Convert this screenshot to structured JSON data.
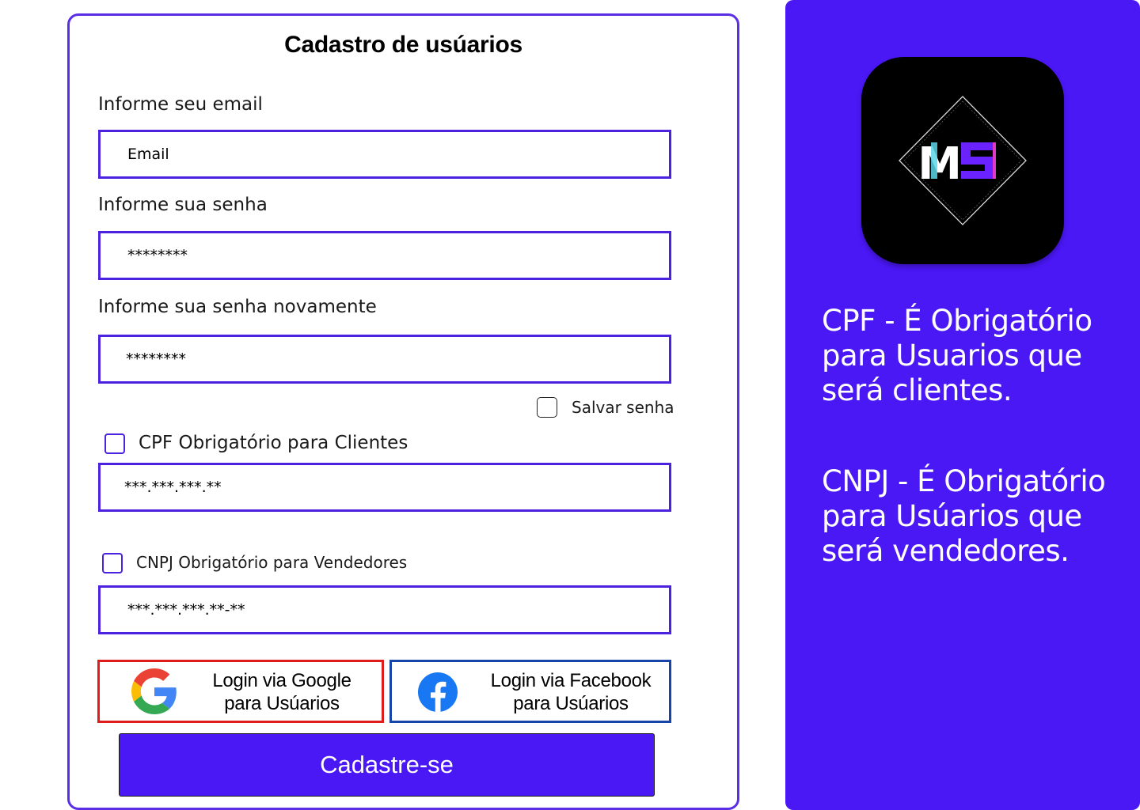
{
  "form": {
    "title": "Cadastro de usúarios",
    "email_label": "Informe seu email",
    "email_placeholder": "Email",
    "password_label": "Informe sua senha",
    "password_placeholder": "********",
    "password_confirm_label": "Informe sua senha novamente",
    "password_confirm_placeholder": "********",
    "save_password_label": "Salvar senha",
    "cpf_checkbox_label": "CPF Obrigatório para Clientes",
    "cpf_placeholder": "***.***.***.**",
    "cnpj_checkbox_label": "CNPJ Obrigatório para Vendedores",
    "cnpj_placeholder": "***.***.***.**-**",
    "google_button_label_line1": "Login via Google",
    "google_button_label_line2": "para Usúarios",
    "facebook_button_label_line1": "Login via Facebook",
    "facebook_button_label_line2": "para Usúarios",
    "submit_label": "Cadastre-se"
  },
  "sidebar": {
    "logo_text": "MS",
    "cpf_info": "CPF - É Obrigatório para Usuarios que será clientes.",
    "cnpj_info": "CNPJ - É Obrigatório para Usúarios que será vendedores."
  },
  "colors": {
    "accent": "#4a17f5",
    "border": "#4b22e0",
    "google_border": "#e01b1b",
    "facebook_border": "#1744a8",
    "facebook_blue": "#1877f2"
  },
  "icons": {
    "google": "google-icon",
    "facebook": "facebook-icon",
    "logo": "ms-logo-icon"
  }
}
